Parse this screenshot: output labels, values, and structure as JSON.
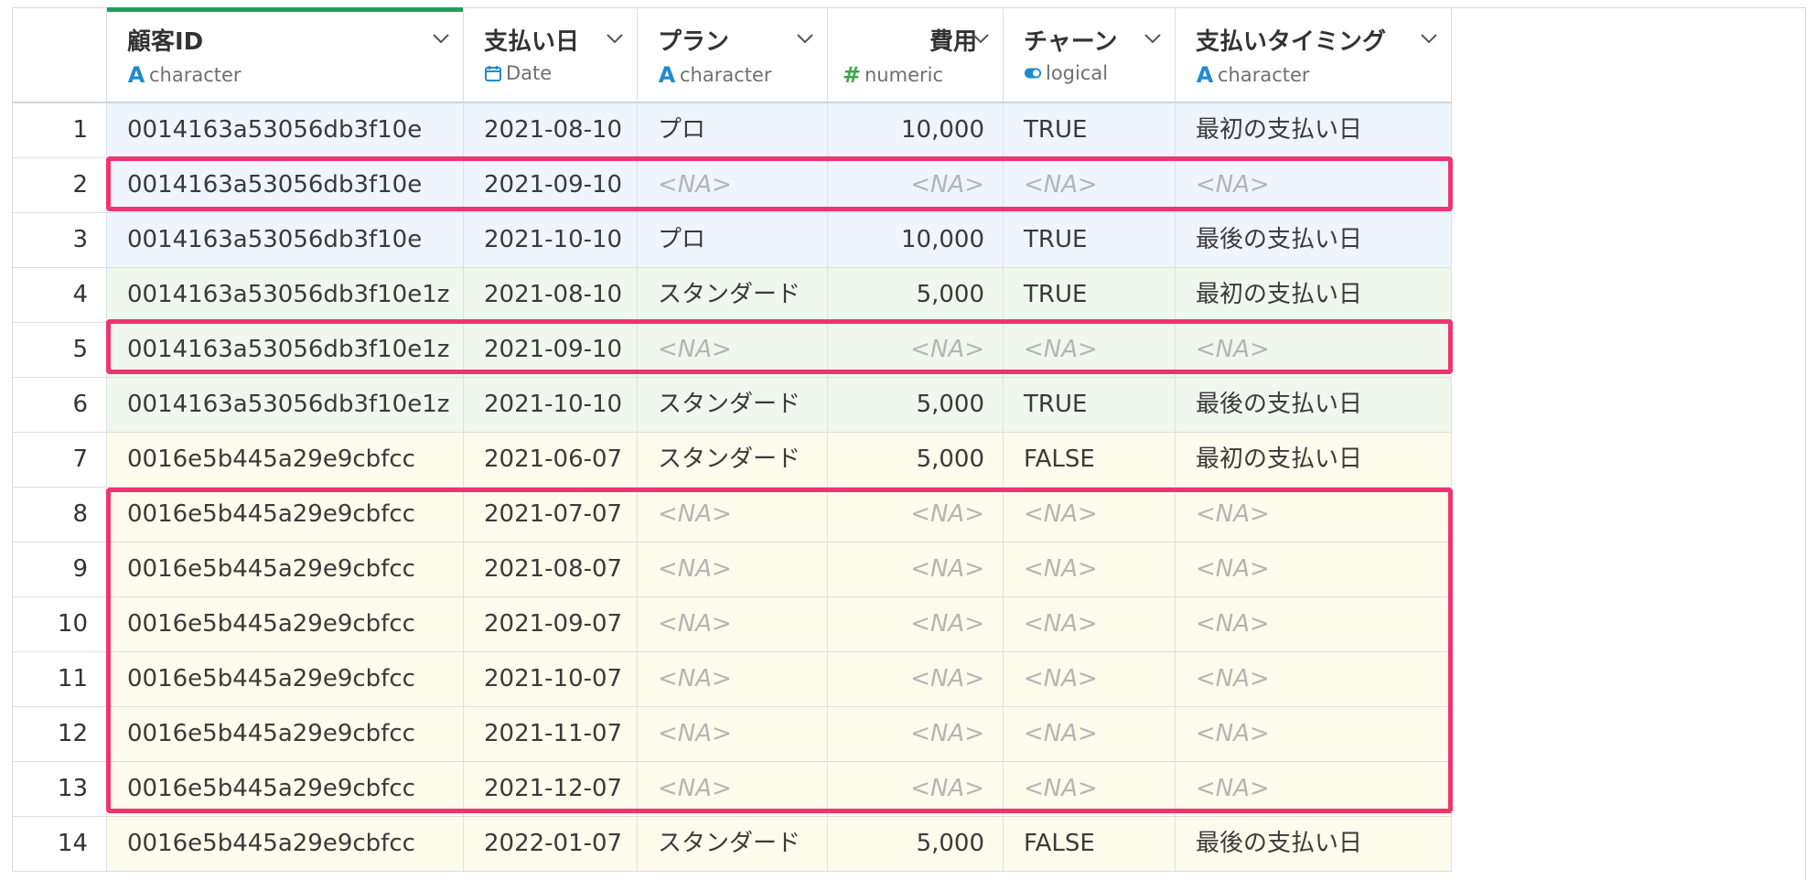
{
  "columns": [
    {
      "name": "顧客ID",
      "type": "character",
      "icon": "character-icon"
    },
    {
      "name": "支払い日",
      "type": "Date",
      "icon": "calendar-icon"
    },
    {
      "name": "プラン",
      "type": "character",
      "icon": "character-icon"
    },
    {
      "name": "費用",
      "type": "numeric",
      "icon": "numeric-icon"
    },
    {
      "name": "チャーン",
      "type": "logical",
      "icon": "logical-toggle-icon"
    },
    {
      "name": "支払いタイミング",
      "type": "character",
      "icon": "character-icon"
    }
  ],
  "rows": [
    {
      "n": "1",
      "id": "0014163a53056db3f10e",
      "date": "2021-08-10",
      "plan": "プロ",
      "cost": "10,000",
      "churn": "TRUE",
      "timing": "最初の支払い日"
    },
    {
      "n": "2",
      "id": "0014163a53056db3f10e",
      "date": "2021-09-10",
      "plan": "<NA>",
      "cost": "<NA>",
      "churn": "<NA>",
      "timing": "<NA>"
    },
    {
      "n": "3",
      "id": "0014163a53056db3f10e",
      "date": "2021-10-10",
      "plan": "プロ",
      "cost": "10,000",
      "churn": "TRUE",
      "timing": "最後の支払い日"
    },
    {
      "n": "4",
      "id": "0014163a53056db3f10e1z",
      "date": "2021-08-10",
      "plan": "スタンダード",
      "cost": "5,000",
      "churn": "TRUE",
      "timing": "最初の支払い日"
    },
    {
      "n": "5",
      "id": "0014163a53056db3f10e1z",
      "date": "2021-09-10",
      "plan": "<NA>",
      "cost": "<NA>",
      "churn": "<NA>",
      "timing": "<NA>"
    },
    {
      "n": "6",
      "id": "0014163a53056db3f10e1z",
      "date": "2021-10-10",
      "plan": "スタンダード",
      "cost": "5,000",
      "churn": "TRUE",
      "timing": "最後の支払い日"
    },
    {
      "n": "7",
      "id": "0016e5b445a29e9cbfcc",
      "date": "2021-06-07",
      "plan": "スタンダード",
      "cost": "5,000",
      "churn": "FALSE",
      "timing": "最初の支払い日"
    },
    {
      "n": "8",
      "id": "0016e5b445a29e9cbfcc",
      "date": "2021-07-07",
      "plan": "<NA>",
      "cost": "<NA>",
      "churn": "<NA>",
      "timing": "<NA>"
    },
    {
      "n": "9",
      "id": "0016e5b445a29e9cbfcc",
      "date": "2021-08-07",
      "plan": "<NA>",
      "cost": "<NA>",
      "churn": "<NA>",
      "timing": "<NA>"
    },
    {
      "n": "10",
      "id": "0016e5b445a29e9cbfcc",
      "date": "2021-09-07",
      "plan": "<NA>",
      "cost": "<NA>",
      "churn": "<NA>",
      "timing": "<NA>"
    },
    {
      "n": "11",
      "id": "0016e5b445a29e9cbfcc",
      "date": "2021-10-07",
      "plan": "<NA>",
      "cost": "<NA>",
      "churn": "<NA>",
      "timing": "<NA>"
    },
    {
      "n": "12",
      "id": "0016e5b445a29e9cbfcc",
      "date": "2021-11-07",
      "plan": "<NA>",
      "cost": "<NA>",
      "churn": "<NA>",
      "timing": "<NA>"
    },
    {
      "n": "13",
      "id": "0016e5b445a29e9cbfcc",
      "date": "2021-12-07",
      "plan": "<NA>",
      "cost": "<NA>",
      "churn": "<NA>",
      "timing": "<NA>"
    },
    {
      "n": "14",
      "id": "0016e5b445a29e9cbfcc",
      "date": "2022-01-07",
      "plan": "スタンダード",
      "cost": "5,000",
      "churn": "FALSE",
      "timing": "最後の支払い日"
    }
  ],
  "colors": {
    "group_a": "#eef5fd",
    "group_b": "#f0f7ec",
    "group_c": "#fcfbec",
    "highlight": "#f0346f",
    "selected_column": "#1aa35f"
  }
}
